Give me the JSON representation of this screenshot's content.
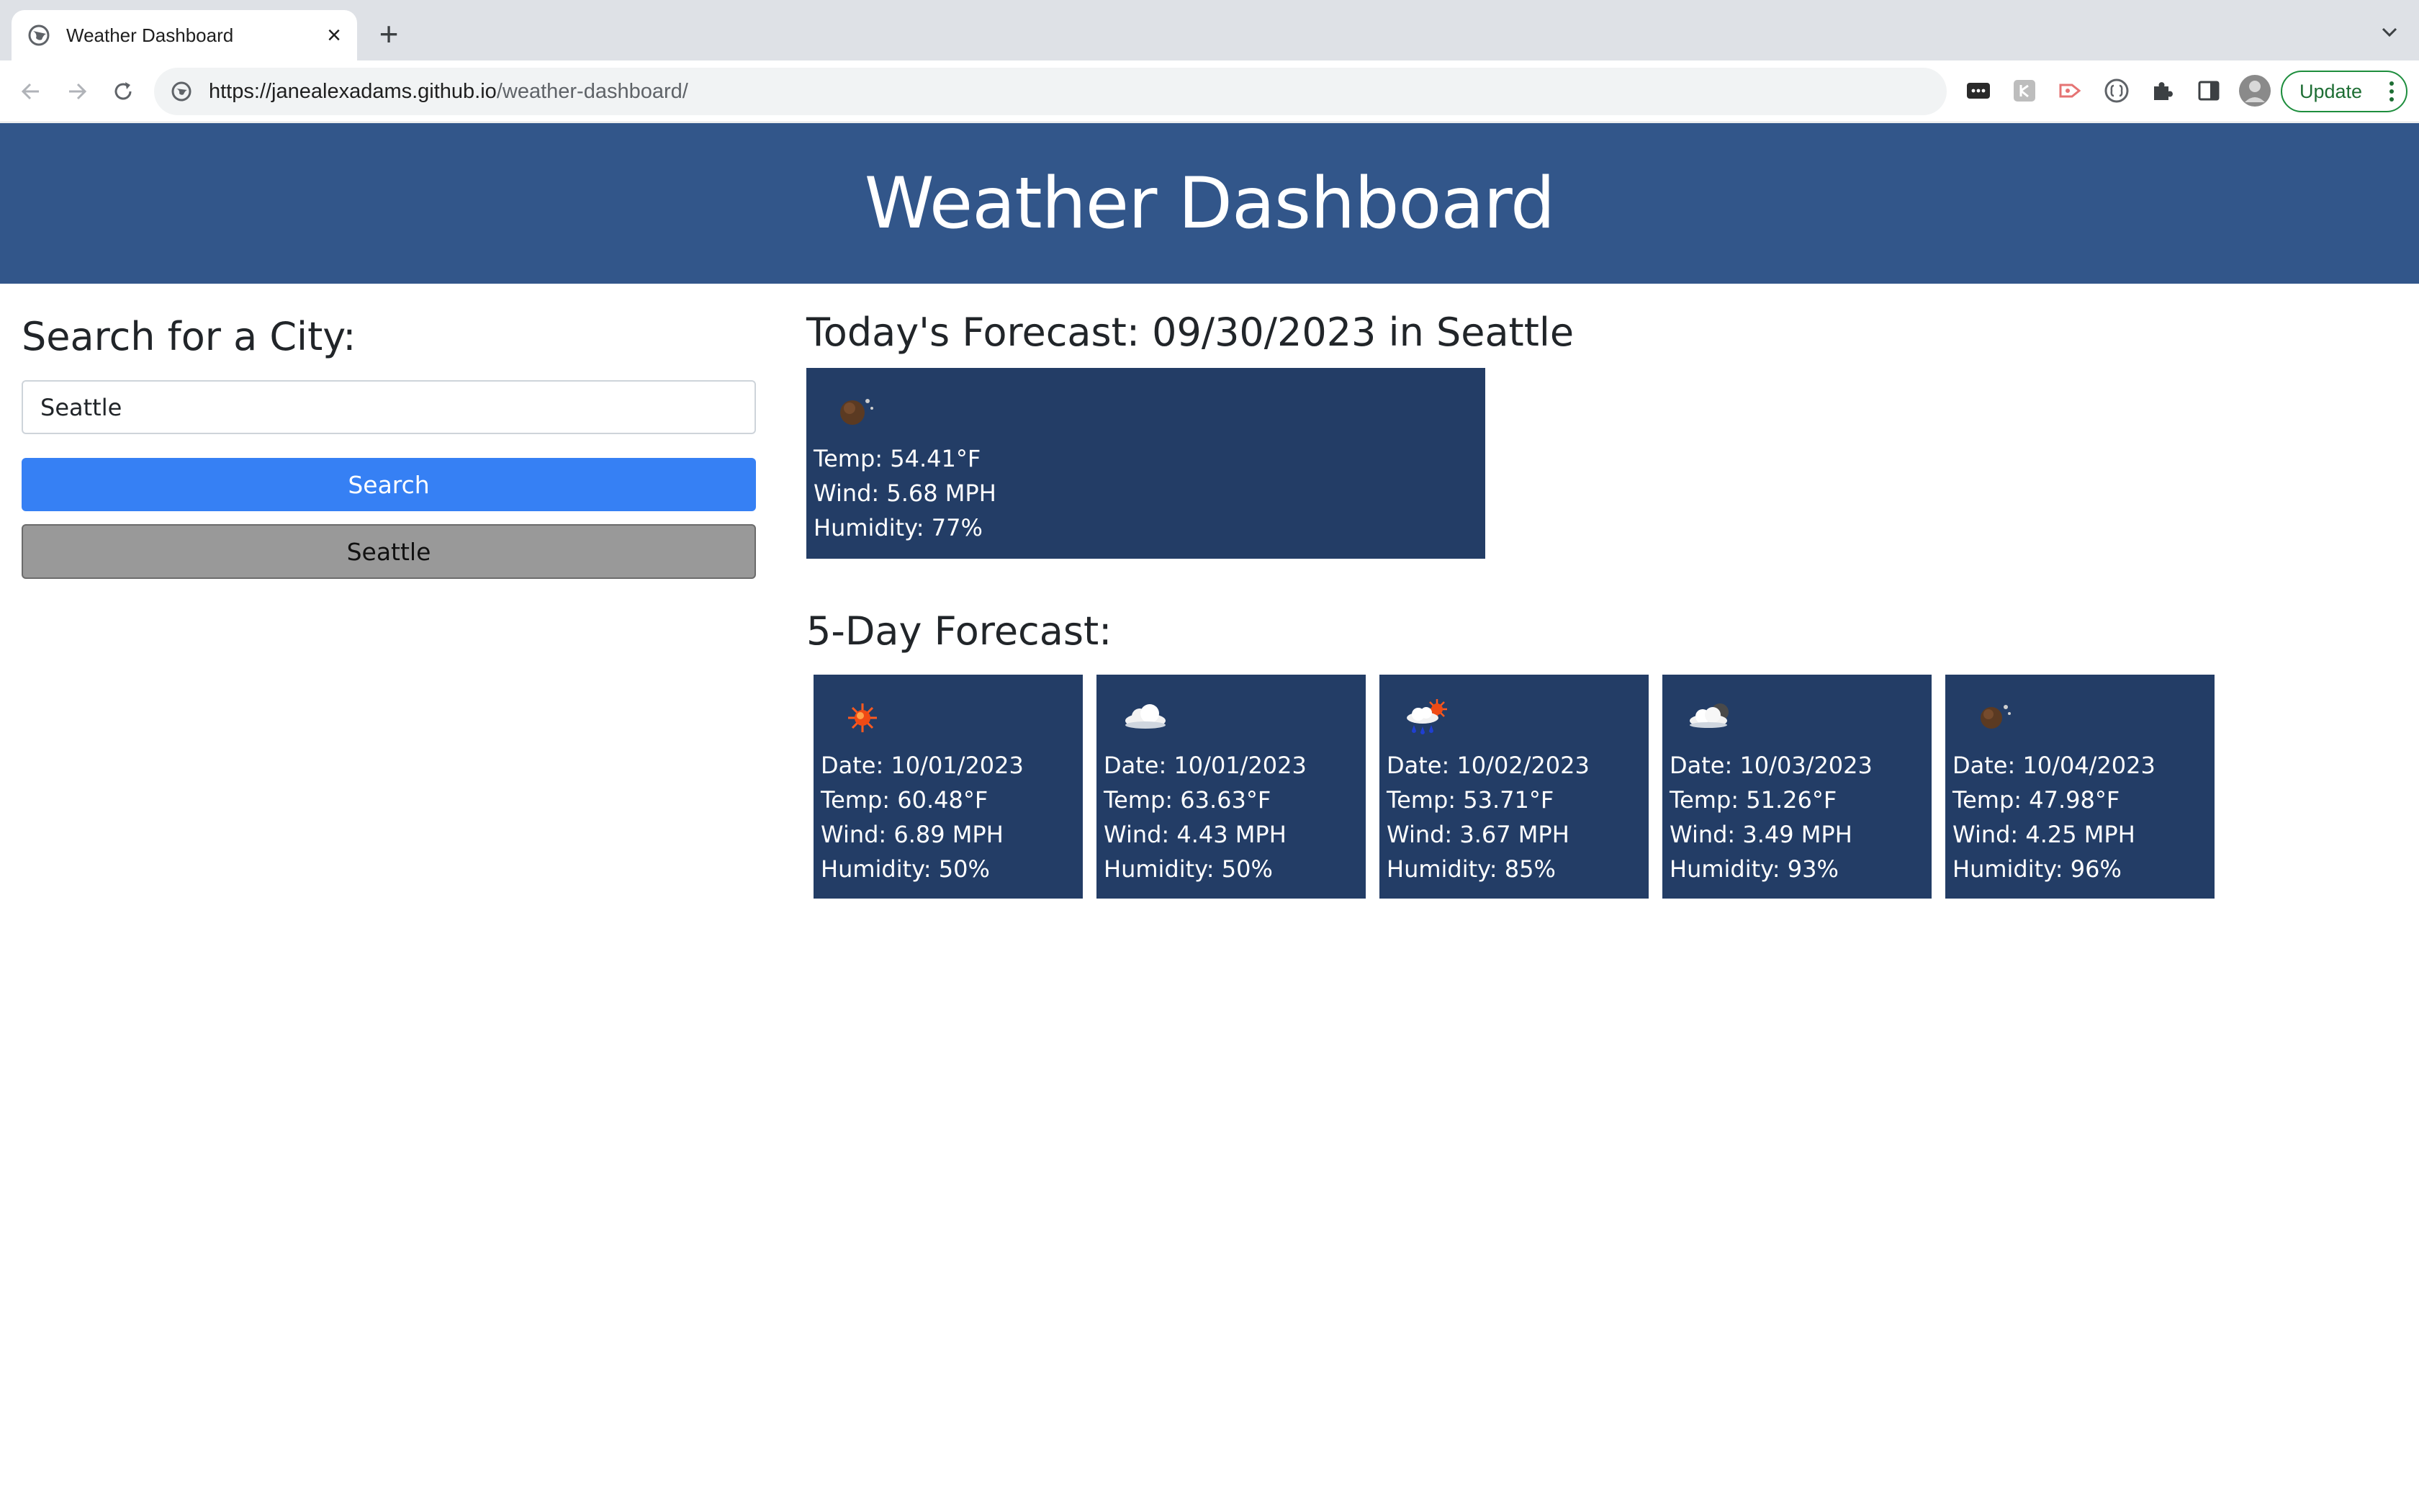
{
  "browser": {
    "tab_title": "Weather Dashboard",
    "tab_close": "×",
    "new_tab": "+",
    "url_host": "https://janealexadams.github.io",
    "url_path": "/weather-dashboard/",
    "update_label": "Update"
  },
  "header": {
    "title": "Weather Dashboard"
  },
  "search": {
    "heading": "Search for a City:",
    "input_value": "Seattle",
    "button_label": "Search",
    "history": [
      "Seattle"
    ]
  },
  "today": {
    "heading": "Today's Forecast: 09/30/2023 in Seattle",
    "icon": "night-moon-icon",
    "temp": "Temp: 54.41°F",
    "wind": "Wind: 5.68 MPH",
    "humidity": "Humidity: 77%"
  },
  "forecast": {
    "heading": "5-Day Forecast:",
    "days": [
      {
        "icon": "sun-icon",
        "date": "Date: 10/01/2023",
        "temp": "Temp: 60.48°F",
        "wind": "Wind: 6.89 MPH",
        "humidity": "Humidity: 50%"
      },
      {
        "icon": "cloud-icon",
        "date": "Date: 10/01/2023",
        "temp": "Temp: 63.63°F",
        "wind": "Wind: 4.43 MPH",
        "humidity": "Humidity: 50%"
      },
      {
        "icon": "sun-rain-cloud-icon",
        "date": "Date: 10/02/2023",
        "temp": "Temp: 53.71°F",
        "wind": "Wind: 3.67 MPH",
        "humidity": "Humidity: 85%"
      },
      {
        "icon": "cloud-moon-icon",
        "date": "Date: 10/03/2023",
        "temp": "Temp: 51.26°F",
        "wind": "Wind: 3.49 MPH",
        "humidity": "Humidity: 93%"
      },
      {
        "icon": "night-moon-icon",
        "date": "Date: 10/04/2023",
        "temp": "Temp: 47.98°F",
        "wind": "Wind: 4.25 MPH",
        "humidity": "Humidity: 96%"
      }
    ]
  },
  "colors": {
    "header_bg": "#32568a",
    "card_bg": "#233d66",
    "search_button": "#3680f4",
    "history_button": "#999999"
  }
}
